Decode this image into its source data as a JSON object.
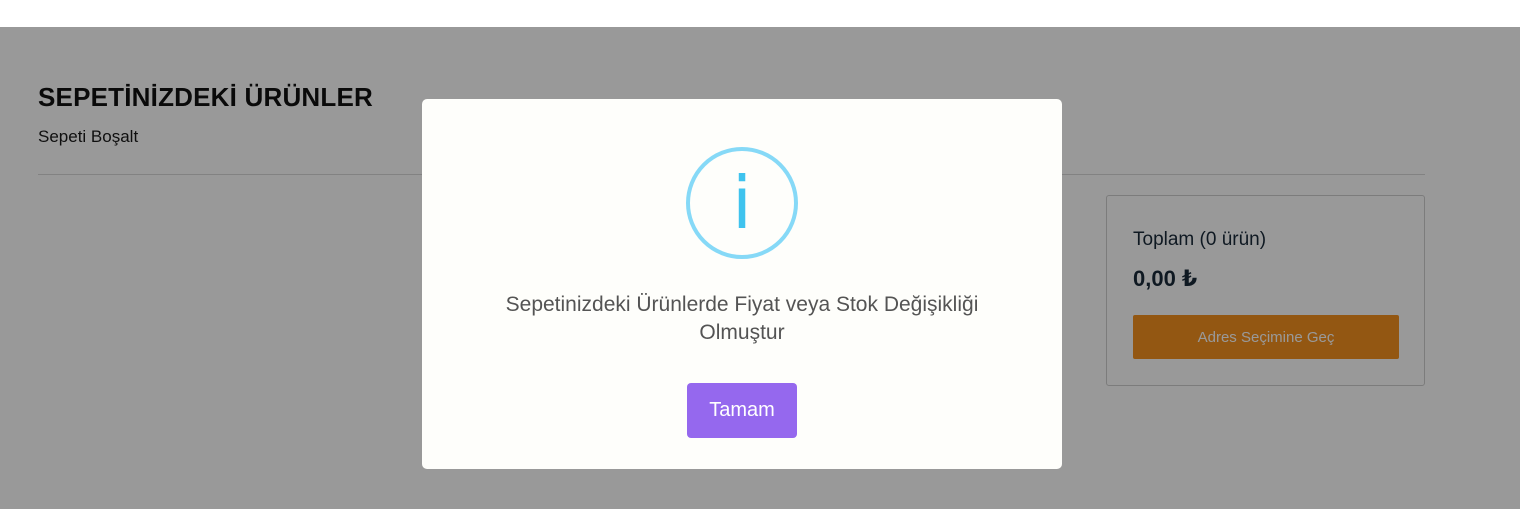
{
  "cart": {
    "title": "SEPETİNİZDEKİ ÜRÜNLER",
    "empty_link": "Sepeti Boşalt"
  },
  "summary": {
    "label": "Toplam (0 ürün)",
    "total": "0,00 ₺",
    "checkout_label": "Adres Seçimine Geç"
  },
  "modal": {
    "icon": "info-icon",
    "icon_glyph": "i",
    "message": "Sepetinizdeki Ürünlerde Fiyat veya Stok Değişikliği Olmuştur",
    "confirm_label": "Tamam"
  },
  "colors": {
    "accent_orange": "#f6921e",
    "confirm_purple": "#9568ee",
    "info_blue": "#3fc3ee"
  }
}
